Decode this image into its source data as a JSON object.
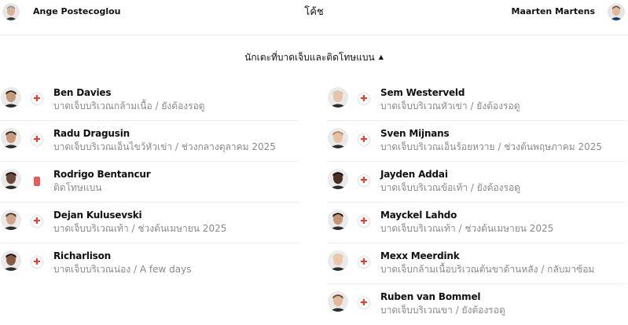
{
  "coaches": {
    "label": "โค้ช",
    "home": {
      "name": "Ange Postecoglou",
      "avatar_icon": "coach-avatar-icon"
    },
    "away": {
      "name": "Maarten Martens",
      "avatar_icon": "coach-avatar-icon"
    }
  },
  "section": {
    "title": "นักเตะที่บาดเจ็บและติดโทษแบน",
    "caret": "▲"
  },
  "home_players": [
    {
      "name": "Ben Davies",
      "detail": "บาดเจ็บบริเวณกล้ามเนื้อ / ยังต้องรอดู",
      "status": "injury",
      "status_icon": "✚",
      "skin": "#c49a7a",
      "hair": "#2a2019"
    },
    {
      "name": "Radu Dragusin",
      "detail": "บาดเจ็บบริเวณเอ็นไขว้หัวเข่า / ช่วงกลางตุลาคม 2025",
      "status": "injury",
      "status_icon": "✚",
      "skin": "#c8977c",
      "hair": "#2e241e"
    },
    {
      "name": "Rodrigo Bentancur",
      "detail": "ติดโทษแบน",
      "status": "suspension",
      "status_icon": "",
      "skin": "#6b4a3a",
      "hair": "#1c1410"
    },
    {
      "name": "Dejan Kulusevski",
      "detail": "บาดเจ็บบริเวณเท้า / ช่วงต้นเมษายน 2025",
      "status": "injury",
      "status_icon": "✚",
      "skin": "#d2a48a",
      "hair": "#4a3526"
    },
    {
      "name": "Richarlison",
      "detail": "บาดเจ็บบริเวณน่อง / A few days",
      "status": "injury",
      "status_icon": "✚",
      "skin": "#8a5a44",
      "hair": "#1a120e"
    }
  ],
  "away_players": [
    {
      "name": "Sem Westerveld",
      "detail": "บาดเจ็บบริเวณหัวเข่า / ยังต้องรอดู",
      "status": "injury",
      "status_icon": "✚",
      "skin": "#e6c3ad",
      "hair": "#d8c9b0"
    },
    {
      "name": "Sven Mijnans",
      "detail": "บาดเจ็บบริเวณเอ็นร้อยหวาย / ช่วงต้นพฤษภาคม 2025",
      "status": "injury",
      "status_icon": "✚",
      "skin": "#e8c0a4",
      "hair": "#b8865a"
    },
    {
      "name": "Jayden Addai",
      "detail": "บาดเจ็บบริเวณข้อเท้า / ยังต้องรอดู",
      "status": "injury",
      "status_icon": "✚",
      "skin": "#4a2e22",
      "hair": "#140c08"
    },
    {
      "name": "Mayckel Lahdo",
      "detail": "บาดเจ็บบริเวณเท้า / ช่วงต้นเมษายน 2025",
      "status": "injury",
      "status_icon": "✚",
      "skin": "#c49474",
      "hair": "#1e1612"
    },
    {
      "name": "Mexx Meerdink",
      "detail": "บาดเจ็บกล้ามเนื้อบริเวณต้นขาด้านหลัง / กลับมาซ้อม",
      "status": "injury",
      "status_icon": "✚",
      "skin": "#ecc7b0",
      "hair": "#e2c9a2"
    },
    {
      "name": "Ruben van Bommel",
      "detail": "บาดเจ็บบริเวณขา / ยังต้องรอดู",
      "status": "injury",
      "status_icon": "✚",
      "skin": "#e2b99c",
      "hair": "#6a4a2e"
    }
  ],
  "colors": {
    "injury": "#e0403a",
    "suspension": "#e45c5c",
    "detail_text": "#8a8a8a",
    "divider": "#eeeeee"
  }
}
